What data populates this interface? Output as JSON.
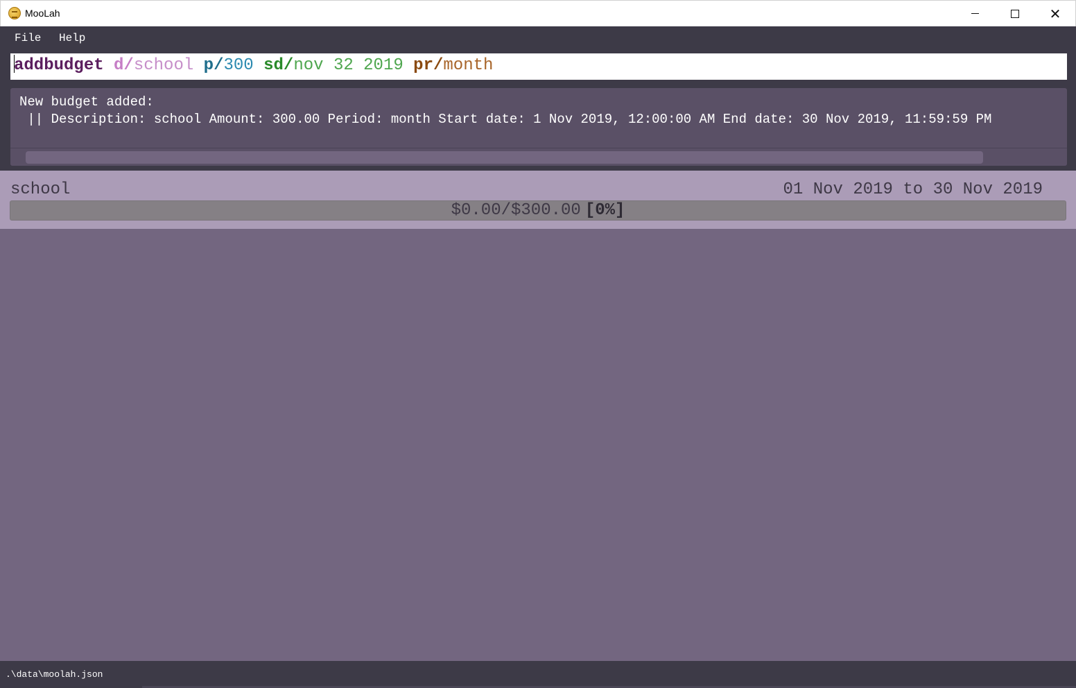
{
  "window": {
    "title": "MooLah",
    "controls": {
      "minimize": "minimize",
      "maximize": "maximize",
      "close": "close"
    }
  },
  "menu": {
    "items": [
      {
        "label": "File"
      },
      {
        "label": "Help"
      }
    ]
  },
  "command": {
    "tokens": {
      "command": "addbudget",
      "description_prefix": "d/",
      "description_value": "school",
      "price_prefix": "p/",
      "price_value": "300",
      "start_date_prefix": "sd/",
      "start_date_value": "nov 32 2019",
      "period_prefix": "pr/",
      "period_value": "month"
    }
  },
  "result": {
    "line1": "New budget added:",
    "line2": " || Description: school Amount: 300.00 Period: month Start date: 1 Nov 2019, 12:00:00 AM End date: 30 Nov 2019, 11:59:59 PM"
  },
  "budgets": [
    {
      "description": "school",
      "dates": "01 Nov 2019 to 30 Nov 2019",
      "amount_text": "$0.00/$300.00",
      "percent_text": "[0%]",
      "progress_fraction": 0.0
    }
  ],
  "status": {
    "file_path": ".\\data\\moolah.json"
  },
  "colors": {
    "background": "#736680",
    "panel_dark": "#3d3a47",
    "result_bg": "#5a5066",
    "budget_card": "#ab9cb7",
    "progress_bg": "#858085"
  }
}
